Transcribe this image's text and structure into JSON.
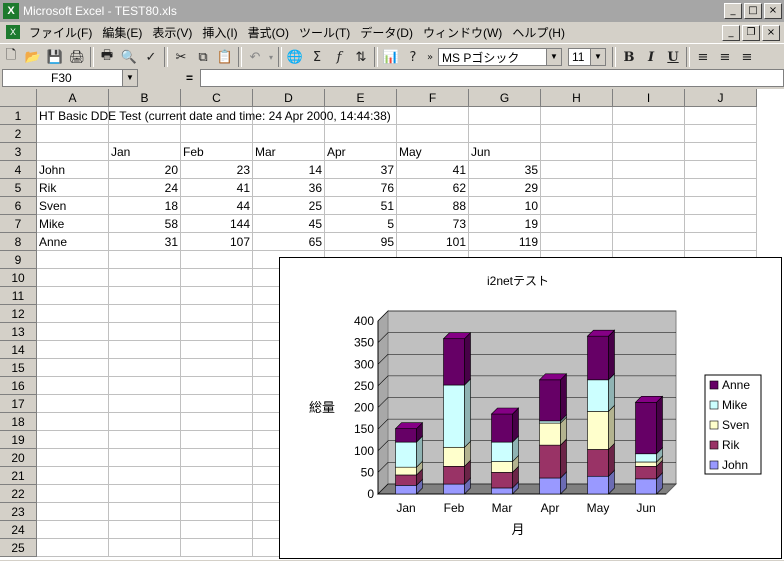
{
  "window": {
    "title": "Microsoft Excel - TEST80.xls",
    "app_icon": "X"
  },
  "menu": [
    "ファイル(F)",
    "編集(E)",
    "表示(V)",
    "挿入(I)",
    "書式(O)",
    "ツール(T)",
    "データ(D)",
    "ウィンドウ(W)",
    "ヘルプ(H)"
  ],
  "toolbar": {
    "font_name": "MS Pゴシック",
    "font_size": "11",
    "bold": "B",
    "italic": "I",
    "underline": "U"
  },
  "formula": {
    "name_box": "F30",
    "equals": "=",
    "content": ""
  },
  "columns": [
    "A",
    "B",
    "C",
    "D",
    "E",
    "F",
    "G",
    "H",
    "I",
    "J"
  ],
  "rows": [
    "1",
    "2",
    "3",
    "4",
    "5",
    "6",
    "7",
    "8",
    "9",
    "10",
    "11",
    "12",
    "13",
    "14",
    "15",
    "16",
    "17",
    "18",
    "19",
    "20",
    "21",
    "22",
    "23",
    "24",
    "25"
  ],
  "sheet": {
    "a1": "HT Basic DDE Test (current date and time: 24 Apr 2000, 14:44:38)",
    "months": [
      "Jan",
      "Feb",
      "Mar",
      "Apr",
      "May",
      "Jun"
    ],
    "people": [
      {
        "name": "John",
        "values": [
          "20",
          "23",
          "14",
          "37",
          "41",
          "35"
        ]
      },
      {
        "name": "Rik",
        "values": [
          "24",
          "41",
          "36",
          "76",
          "62",
          "29"
        ]
      },
      {
        "name": "Sven",
        "values": [
          "18",
          "44",
          "25",
          "51",
          "88",
          "10"
        ]
      },
      {
        "name": "Mike",
        "values": [
          "58",
          "144",
          "45",
          "5",
          "73",
          "19"
        ]
      },
      {
        "name": "Anne",
        "values": [
          "31",
          "107",
          "65",
          "95",
          "101",
          "119"
        ]
      }
    ]
  },
  "chart_data": {
    "type": "bar",
    "stacked": true,
    "title": "i2netテスト",
    "xlabel": "月",
    "ylabel": "総量",
    "categories": [
      "Jan",
      "Feb",
      "Mar",
      "Apr",
      "May",
      "Jun"
    ],
    "ylim": [
      0,
      400
    ],
    "yticks": [
      "0",
      "50",
      "100",
      "150",
      "200",
      "250",
      "300",
      "350",
      "400"
    ],
    "grid": true,
    "legend_position": "right",
    "series": [
      {
        "name": "John",
        "values": [
          20,
          23,
          14,
          37,
          41,
          35
        ],
        "color": "#9999ff"
      },
      {
        "name": "Rik",
        "values": [
          24,
          41,
          36,
          76,
          62,
          29
        ],
        "color": "#993366"
      },
      {
        "name": "Sven",
        "values": [
          18,
          44,
          25,
          51,
          88,
          10
        ],
        "color": "#ffffcc"
      },
      {
        "name": "Mike",
        "values": [
          58,
          144,
          45,
          5,
          73,
          19
        ],
        "color": "#ccffff"
      },
      {
        "name": "Anne",
        "values": [
          31,
          107,
          65,
          95,
          101,
          119
        ],
        "color": "#660066"
      }
    ],
    "legend_order": [
      "Anne",
      "Mike",
      "Sven",
      "Rik",
      "John"
    ]
  }
}
